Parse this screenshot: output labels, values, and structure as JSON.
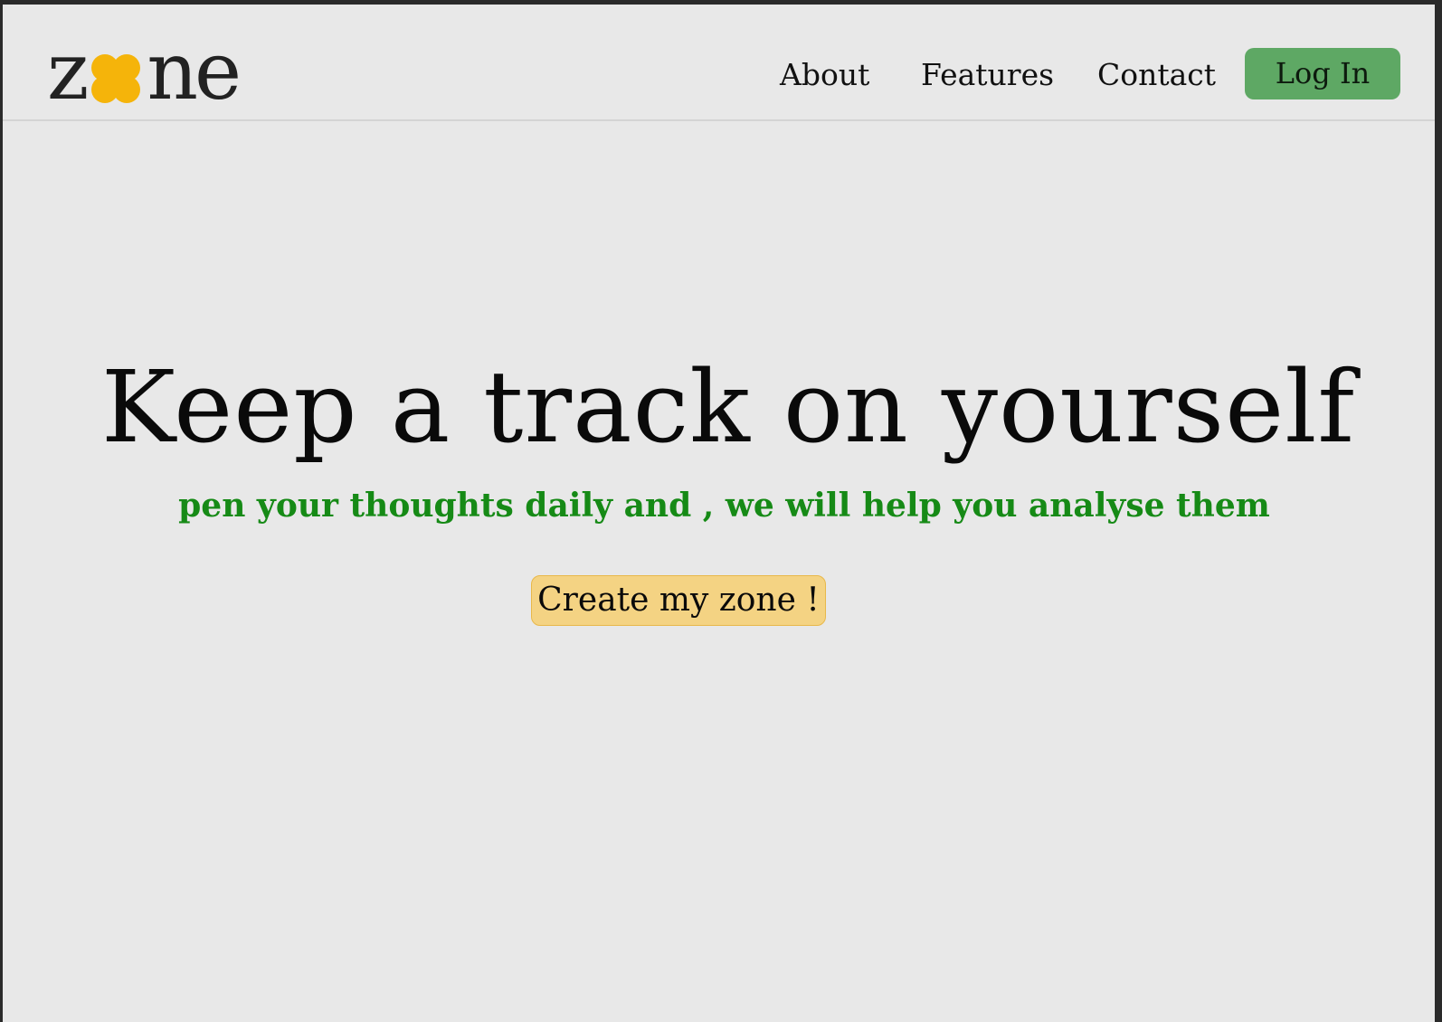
{
  "brand": {
    "logo_letters_before": "z",
    "logo_letters_after": "ne",
    "logo_accent_color": "#f5b40a",
    "logo_icon": "clover-icon"
  },
  "nav": {
    "links": [
      "About",
      "Features",
      "Contact"
    ],
    "login_label": "Log In",
    "login_color": "#5ea864"
  },
  "hero": {
    "title": "Keep a track on yourself",
    "subtitle": "pen your thoughts daily and , we will help you analyse them",
    "subtitle_color": "#168a16",
    "cta_label": "Create my zone !",
    "cta_color": "#f4d383"
  }
}
